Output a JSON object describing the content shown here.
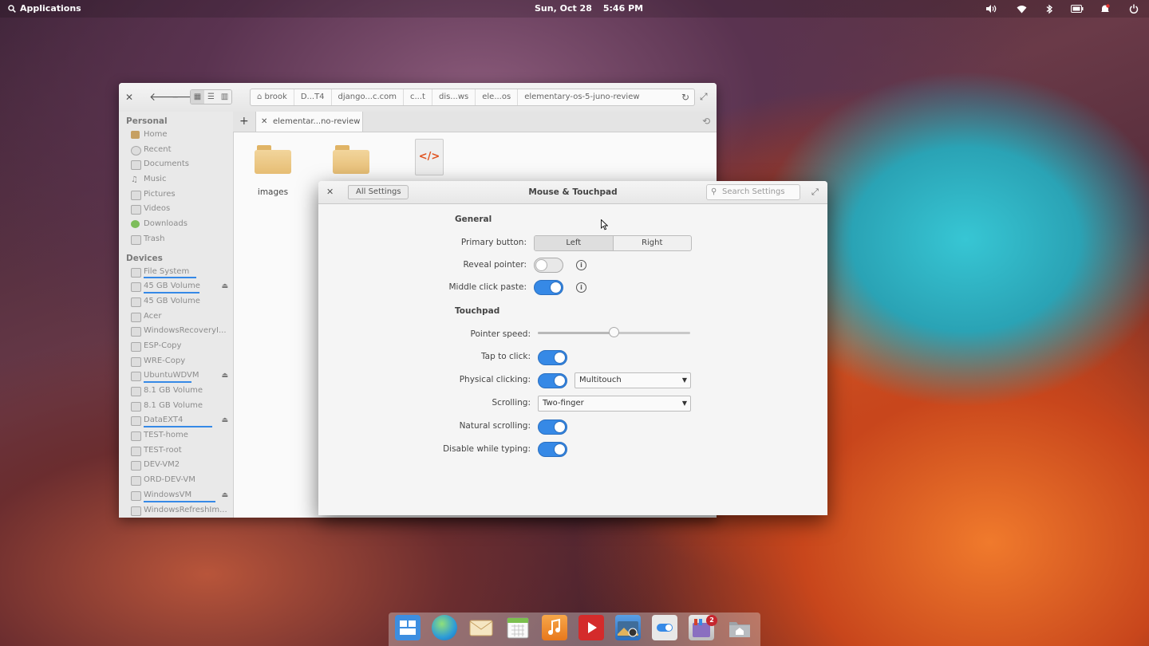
{
  "panel": {
    "applications_label": "Applications",
    "date": "Sun, Oct 28",
    "time": "5:46 PM",
    "indicators": [
      "volume-icon",
      "wifi-icon",
      "bluetooth-icon",
      "battery-icon",
      "notifications-icon",
      "power-icon"
    ]
  },
  "files": {
    "breadcrumb": [
      "brook",
      "D...T4",
      "django...c.com",
      "c...t",
      "dis...ws",
      "ele...os",
      "elementary-os-5-juno-review"
    ],
    "tab_label": "elementar...no-review",
    "sidebar": {
      "personal_header": "Personal",
      "personal": [
        "Home",
        "Recent",
        "Documents",
        "Music",
        "Pictures",
        "Videos",
        "Downloads",
        "Trash"
      ],
      "devices_header": "Devices",
      "devices": [
        "File System",
        "45 GB Volume",
        "45 GB Volume",
        "Acer",
        "WindowsRecoveryI...",
        "ESP-Copy",
        "WRE-Copy",
        "UbuntuWDVM",
        "8.1 GB Volume",
        "8.1 GB Volume",
        "DataEXT4",
        "TEST-home",
        "TEST-root",
        "DEV-VM2",
        "ORD-DEV-VM",
        "WindowsVM",
        "WindowsRefreshIm..."
      ]
    },
    "items": [
      {
        "name": "images",
        "icon": "folder-icon"
      },
      {
        "name": "",
        "icon": "folder-icon"
      },
      {
        "name": "",
        "icon": "code-file-icon",
        "glyph": "</>"
      }
    ]
  },
  "settings": {
    "back_label": "All Settings",
    "title": "Mouse & Touchpad",
    "search_placeholder": "Search Settings",
    "general_header": "General",
    "primary_button_label": "Primary button:",
    "primary_options": [
      "Left",
      "Right"
    ],
    "primary_selected": "Left",
    "reveal_pointer_label": "Reveal pointer:",
    "reveal_pointer": false,
    "middle_click_label": "Middle click paste:",
    "middle_click": true,
    "touchpad_header": "Touchpad",
    "pointer_speed_label": "Pointer speed:",
    "pointer_speed": 0.5,
    "tap_to_click_label": "Tap to click:",
    "tap_to_click": true,
    "physical_clicking_label": "Physical clicking:",
    "physical_clicking": true,
    "physical_clicking_mode": "Multitouch",
    "scrolling_label": "Scrolling:",
    "scrolling_mode": "Two-finger",
    "natural_scrolling_label": "Natural scrolling:",
    "natural_scrolling": true,
    "disable_typing_label": "Disable while typing:",
    "disable_typing": true
  },
  "dock": {
    "apps": [
      "multitasking-view-icon",
      "web-browser-icon",
      "mail-icon",
      "calendar-icon",
      "music-icon",
      "videos-icon",
      "photos-icon",
      "system-settings-icon",
      "appcenter-icon",
      "files-icon"
    ],
    "appcenter_badge": "2"
  }
}
